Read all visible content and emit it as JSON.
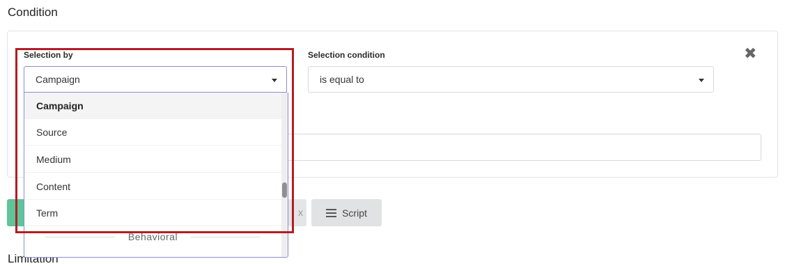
{
  "condition": {
    "title": "Condition",
    "selection_by": {
      "label": "Selection by",
      "value": "Campaign",
      "options": [
        "Campaign",
        "Source",
        "Medium",
        "Content",
        "Term"
      ],
      "group_header": "Behavioral",
      "selected_option": "Campaign"
    },
    "selection_condition": {
      "label": "Selection condition",
      "value": "is equal to"
    }
  },
  "buttons": {
    "script_label": "Script",
    "partial_label": "x"
  },
  "limitation_title": "Limitation",
  "colors": {
    "accent_green": "#5ec49a",
    "highlight_red": "#b01e23",
    "dropdown_border": "#8a8fcf"
  }
}
